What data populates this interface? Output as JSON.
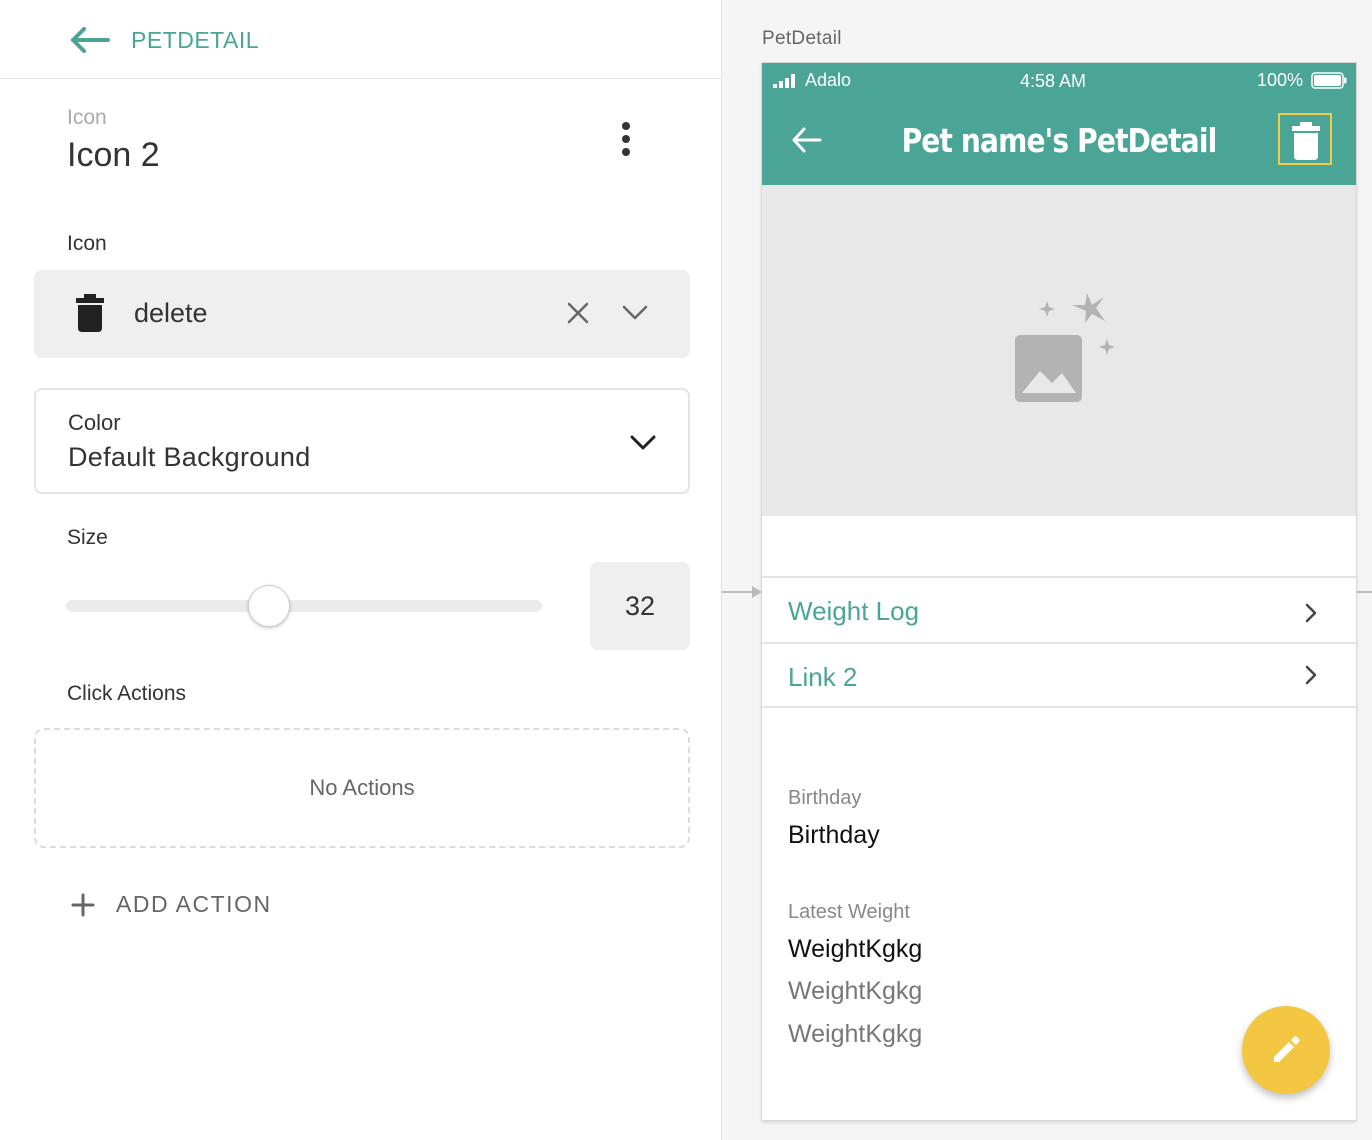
{
  "editor": {
    "screen_name": "PETDETAIL",
    "component_type": "Icon",
    "component_name": "Icon 2",
    "icon_label": "Icon",
    "icon_value": "delete",
    "color_label": "Color",
    "color_value": "Default Background",
    "size_label": "Size",
    "size_value": "32",
    "click_actions_label": "Click Actions",
    "no_actions_text": "No Actions",
    "add_action_label": "ADD ACTION",
    "accent_color": "#4aa596"
  },
  "preview": {
    "screen_label": "PetDetail",
    "status_bar": {
      "carrier": "Adalo",
      "time": "4:58 AM",
      "battery": "100%"
    },
    "app_bar_title": "Pet name's PetDetail",
    "list_items": [
      {
        "label": "Weight Log"
      },
      {
        "label": "Link 2"
      }
    ],
    "birthday_label": "Birthday",
    "birthday_value": "Birthday",
    "latest_weight_label": "Latest Weight",
    "weights": [
      "WeightKgkg",
      "WeightKgkg",
      "WeightKgkg"
    ],
    "fab_icon": "pencil-icon",
    "fab_color": "#f4c742",
    "header_color": "#4aa596",
    "selection_color": "#f3c94a"
  }
}
